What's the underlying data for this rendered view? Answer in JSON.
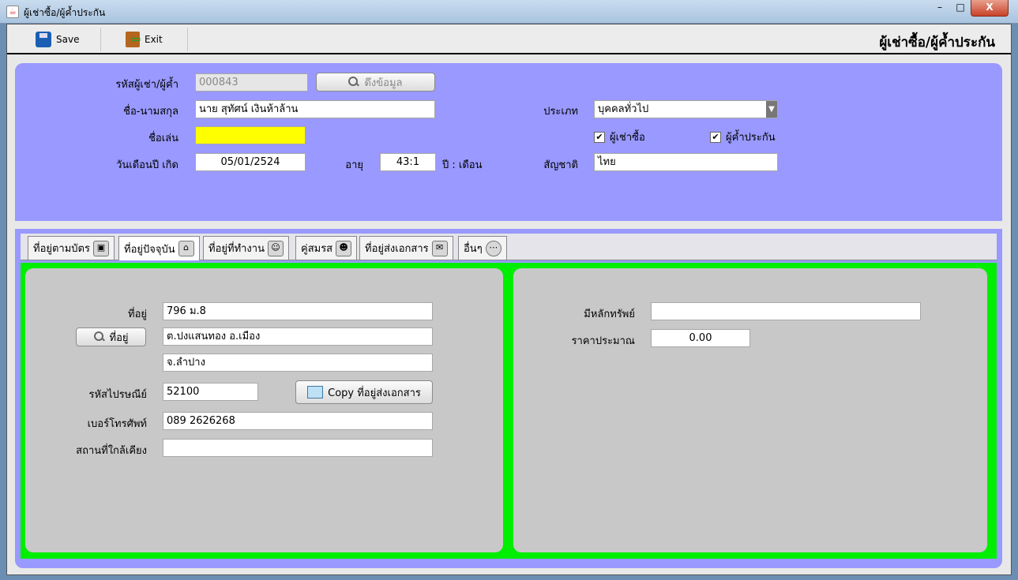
{
  "window": {
    "title": "ผู้เช่าซื้อ/ผู้ค้ำประกัน",
    "close_label": "X",
    "min_label": "–",
    "max_label": "□"
  },
  "toolbar": {
    "save_label": "Save",
    "exit_label": "Exit",
    "page_title": "ผู้เช่าซื้อ/ผู้ค้ำประกัน"
  },
  "form": {
    "code_label": "รหัสผู้เช่า/ผู้ค้ำ",
    "code_value": "000843",
    "fetch_button": "ดึงข้อมูล",
    "name_label": "ชื่อ-นามสกุล",
    "name_value": "นาย สุทัศน์ เงินห้าล้าน",
    "nickname_label": "ชื่อเล่น",
    "nickname_value": "",
    "dob_label": "วันเดือนปี เกิด",
    "dob_value": "05/01/2524",
    "age_label": "อายุ",
    "age_value": "43:1",
    "age_unit": "ปี : เดือน",
    "type_label": "ประเภท",
    "type_value": "บุคคลทั่วไป",
    "renter_checkbox": "ผู้เช่าซื้อ",
    "guarantor_checkbox": "ผู้ค้ำประกัน",
    "nationality_label": "สัญชาติ",
    "nationality_value": "ไทย"
  },
  "tabs": [
    {
      "label": "ที่อยู่ตามบัตร",
      "icon": "id-card-icon"
    },
    {
      "label": "ที่อยู่ปัจจุบัน",
      "icon": "house-icon"
    },
    {
      "label": "ที่อยู่ที่ทำงาน",
      "icon": "office-worker-icon"
    },
    {
      "label": "คู่สมรส",
      "icon": "couple-icon"
    },
    {
      "label": "ที่อยู่ส่งเอกสาร",
      "icon": "envelope-icon"
    },
    {
      "label": "อื่นๆ",
      "icon": "more-icon"
    }
  ],
  "address": {
    "address_label": "ที่อยู่",
    "line1": "796 ม.8",
    "search_button": "ที่อยู่",
    "line2": "ต.ปงแสนทอง อ.เมือง",
    "line3": "จ.ลำปาง",
    "postal_label": "รหัสไปรษณีย์",
    "postal_value": "52100",
    "copy_button": "Copy ที่อยู่ส่งเอกสาร",
    "phone_label": "เบอร์โทรศัพท์",
    "phone_value": "089 2626268",
    "nearby_label": "สถานที่ใกล้เคียง",
    "nearby_value": ""
  },
  "assets": {
    "collateral_label": "มีหลักทรัพย์",
    "collateral_value": "",
    "price_label": "ราคาประมาณ",
    "price_value": "0.00"
  }
}
